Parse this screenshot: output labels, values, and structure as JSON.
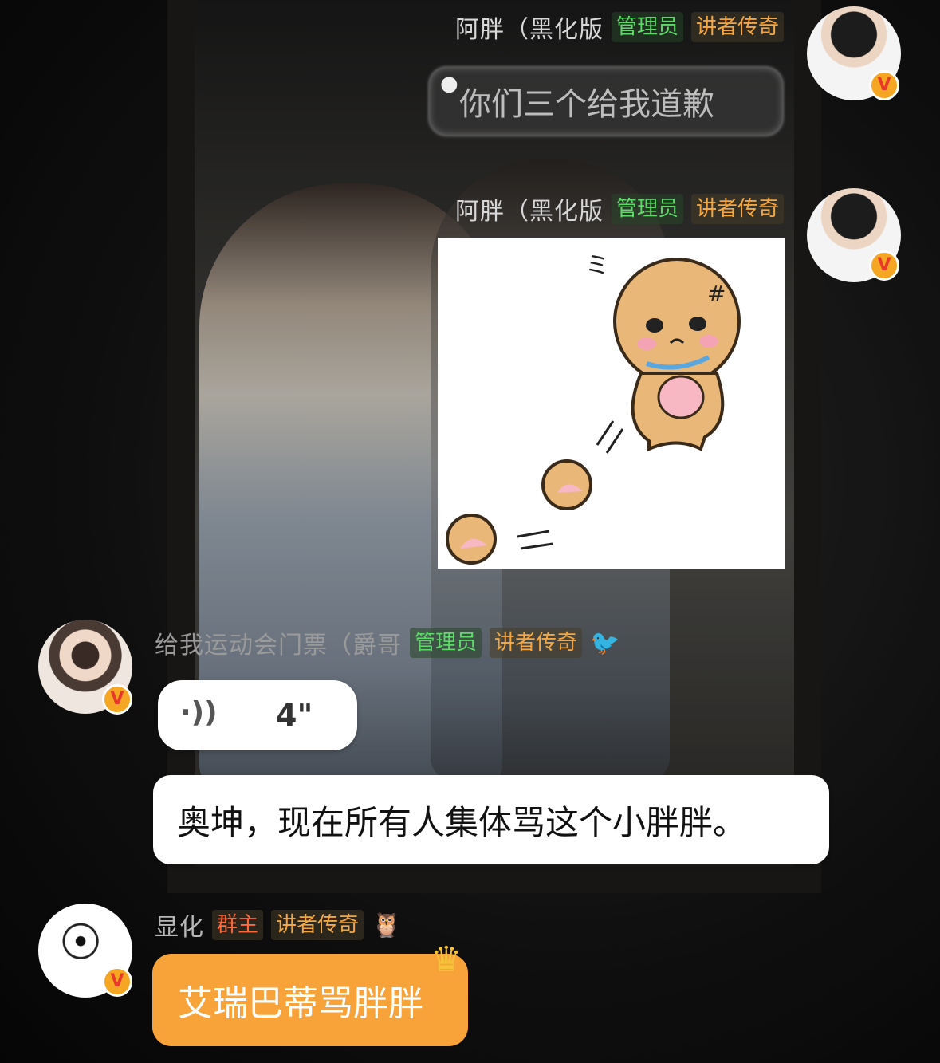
{
  "messages": [
    {
      "user": "阿胖（黑化版",
      "tags": [
        "管理员",
        "讲者传奇"
      ],
      "text": "你们三个给我道歉"
    },
    {
      "user": "阿胖（黑化版",
      "tags": [
        "管理员",
        "讲者传奇"
      ],
      "sticker": "angry-bun-sticker"
    },
    {
      "user": "给我运动会门票（爵哥",
      "tags": [
        "管理员",
        "讲者传奇"
      ],
      "emoji": "🐦",
      "voice_duration": "4\"",
      "text": "奥坤，现在所有人集体骂这个小胖胖。"
    },
    {
      "user": "显化",
      "tags": [
        "群主",
        "讲者传奇"
      ],
      "emoji": "🦉",
      "text": "艾瑞巴蒂骂胖胖"
    }
  ],
  "badge_letter": "V",
  "colors": {
    "green_tag": "#5fd86a",
    "orange_tag": "#f4a640",
    "owner_tag": "#ff6a3a",
    "orange_bubble": "#f7a33a"
  }
}
